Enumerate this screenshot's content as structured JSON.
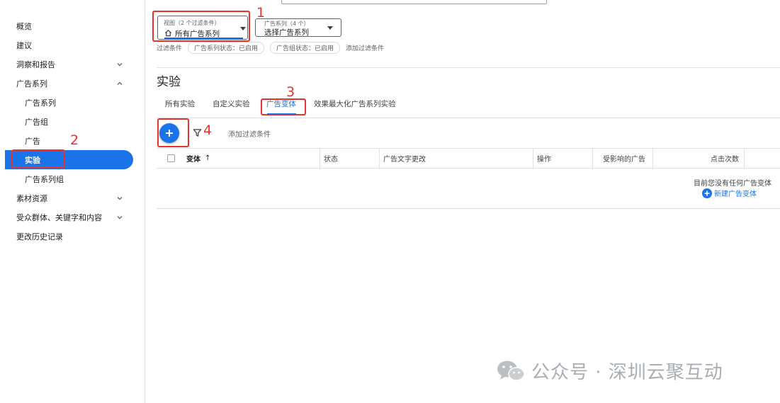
{
  "sidebar": {
    "items": [
      {
        "label": "概览"
      },
      {
        "label": "建议"
      },
      {
        "label": "洞察和报告"
      },
      {
        "label": "广告系列"
      },
      {
        "label": "广告系列"
      },
      {
        "label": "广告组"
      },
      {
        "label": "广告"
      },
      {
        "label": "实验"
      },
      {
        "label": "广告系列组"
      },
      {
        "label": "素材资源"
      },
      {
        "label": "受众群体、关键字和内容"
      },
      {
        "label": "更改历史记录"
      }
    ]
  },
  "header": {
    "view_dropdown": {
      "caption": "视图（2 个过滤条件）",
      "value": "所有广告系列"
    },
    "campaign_dropdown": {
      "caption": "广告系列（4 个）",
      "value": "选择广告系列"
    },
    "filters": {
      "label": "过滤条件",
      "chips": [
        "广告系列状态：已启用",
        "广告组状态：已启用"
      ],
      "add_label": "添加过滤条件"
    }
  },
  "page": {
    "title": "实验",
    "tabs": [
      {
        "label": "所有实验"
      },
      {
        "label": "自定义实验"
      },
      {
        "label": "广告变体"
      },
      {
        "label": "效果最大化广告系列实验"
      }
    ],
    "active_tab": "广告变体"
  },
  "toolbar": {
    "add_filter_label": "添加过滤条件"
  },
  "table": {
    "columns": [
      {
        "label": "变体",
        "sort": "↑"
      },
      {
        "label": "状态"
      },
      {
        "label": "广告文字更改"
      },
      {
        "label": "操作"
      },
      {
        "label": "受影响的广告"
      },
      {
        "label": "点击次数"
      }
    ],
    "empty_message": "目前您没有任何广告变体",
    "new_link": "新建广告变体"
  },
  "annotations": [
    "1",
    "2",
    "3",
    "4"
  ],
  "watermark": {
    "text": "公众号 · 深圳云聚互动",
    "icon": "wechat-icon"
  },
  "colors": {
    "accent": "#1a73e8",
    "annotation": "#e8322d"
  }
}
